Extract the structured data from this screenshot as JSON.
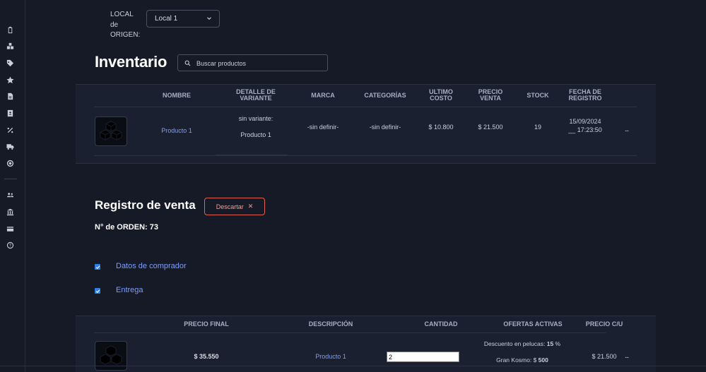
{
  "sidebar": {
    "icons": [
      "clipboard-icon",
      "boxes-icon",
      "tag-icon",
      "star-icon",
      "document-icon",
      "contact-book-icon",
      "percent-icon",
      "truck-icon",
      "target-icon",
      "users-icon",
      "bank-icon",
      "credit-card-icon",
      "help-icon"
    ]
  },
  "origin": {
    "label_line1": "LOCAL",
    "label_line2": "de",
    "label_line3": "ORIGEN:",
    "selected": "Local 1"
  },
  "inventory": {
    "title": "Inventario",
    "search_placeholder": "Buscar productos",
    "headers": {
      "nombre": "NOMBRE",
      "detalle_1": "DETALLE DE",
      "detalle_2": "VARIANTE",
      "marca": "MARCA",
      "categorias": "CATEGORÍAS",
      "ultimo_1": "ULTIMO",
      "ultimo_2": "COSTO",
      "precio_1": "PRECIO",
      "precio_2": "VENTA",
      "stock": "STOCK",
      "fecha_1": "FECHA DE",
      "fecha_2": "REGISTRO"
    },
    "row": {
      "nombre": "Producto 1",
      "variante_1": "sin variante:",
      "variante_2": "Producto 1",
      "marca": "-sin definir-",
      "categorias": "-sin definir-",
      "ultimo_costo": "$ 10.800",
      "precio_venta": "$ 21.500",
      "stock": "19",
      "fecha_1": "15/09/2024",
      "fecha_2": "__ 17:23:50",
      "menu": "..."
    }
  },
  "sale": {
    "title": "Registro de venta",
    "discard_label": "Descartar",
    "discard_x": "✕",
    "order_label": "N° de ORDEN: 73",
    "buyer_label": "Datos de comprador",
    "delivery_label": "Entrega",
    "buyer_checked": true,
    "delivery_checked": true,
    "headers": {
      "precio_final": "PRECIO FINAL",
      "descripcion": "DESCRIPCIÓN",
      "cantidad": "CANTIDAD",
      "ofertas": "OFERTAS ACTIVAS",
      "precio_cu": "PRECIO C/U"
    },
    "row": {
      "precio_final": "$ 35.550",
      "descripcion": "Producto 1",
      "cantidad": "2",
      "oferta1_text": "Descuento en pelucas: ",
      "oferta1_value": "15",
      "oferta1_suffix": " %",
      "oferta2_text": "Gran Kosmo: $ ",
      "oferta2_value": "500",
      "precio_cu": "$ 21.500",
      "menu": "..."
    }
  },
  "colors": {
    "background": "#161a26",
    "panel": "#1b2030",
    "link": "#7c9dff",
    "discard": "#e1604e",
    "checkbox": "#2f7fe8"
  }
}
